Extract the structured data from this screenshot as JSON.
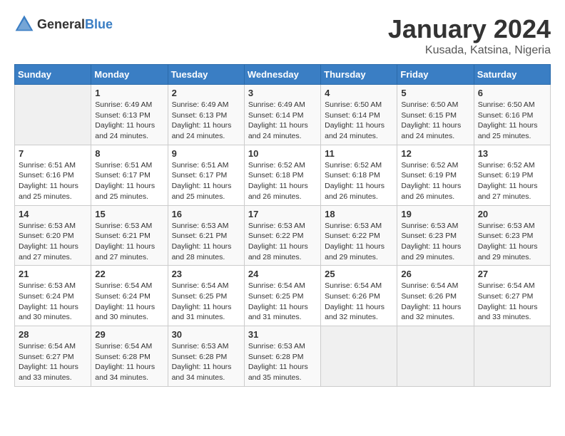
{
  "header": {
    "logo_general": "General",
    "logo_blue": "Blue",
    "month": "January 2024",
    "location": "Kusada, Katsina, Nigeria"
  },
  "weekdays": [
    "Sunday",
    "Monday",
    "Tuesday",
    "Wednesday",
    "Thursday",
    "Friday",
    "Saturday"
  ],
  "weeks": [
    [
      {
        "day": "",
        "info": ""
      },
      {
        "day": "1",
        "info": "Sunrise: 6:49 AM\nSunset: 6:13 PM\nDaylight: 11 hours and 24 minutes."
      },
      {
        "day": "2",
        "info": "Sunrise: 6:49 AM\nSunset: 6:13 PM\nDaylight: 11 hours and 24 minutes."
      },
      {
        "day": "3",
        "info": "Sunrise: 6:49 AM\nSunset: 6:14 PM\nDaylight: 11 hours and 24 minutes."
      },
      {
        "day": "4",
        "info": "Sunrise: 6:50 AM\nSunset: 6:14 PM\nDaylight: 11 hours and 24 minutes."
      },
      {
        "day": "5",
        "info": "Sunrise: 6:50 AM\nSunset: 6:15 PM\nDaylight: 11 hours and 24 minutes."
      },
      {
        "day": "6",
        "info": "Sunrise: 6:50 AM\nSunset: 6:16 PM\nDaylight: 11 hours and 25 minutes."
      }
    ],
    [
      {
        "day": "7",
        "info": "Sunrise: 6:51 AM\nSunset: 6:16 PM\nDaylight: 11 hours and 25 minutes."
      },
      {
        "day": "8",
        "info": "Sunrise: 6:51 AM\nSunset: 6:17 PM\nDaylight: 11 hours and 25 minutes."
      },
      {
        "day": "9",
        "info": "Sunrise: 6:51 AM\nSunset: 6:17 PM\nDaylight: 11 hours and 25 minutes."
      },
      {
        "day": "10",
        "info": "Sunrise: 6:52 AM\nSunset: 6:18 PM\nDaylight: 11 hours and 26 minutes."
      },
      {
        "day": "11",
        "info": "Sunrise: 6:52 AM\nSunset: 6:18 PM\nDaylight: 11 hours and 26 minutes."
      },
      {
        "day": "12",
        "info": "Sunrise: 6:52 AM\nSunset: 6:19 PM\nDaylight: 11 hours and 26 minutes."
      },
      {
        "day": "13",
        "info": "Sunrise: 6:52 AM\nSunset: 6:19 PM\nDaylight: 11 hours and 27 minutes."
      }
    ],
    [
      {
        "day": "14",
        "info": "Sunrise: 6:53 AM\nSunset: 6:20 PM\nDaylight: 11 hours and 27 minutes."
      },
      {
        "day": "15",
        "info": "Sunrise: 6:53 AM\nSunset: 6:21 PM\nDaylight: 11 hours and 27 minutes."
      },
      {
        "day": "16",
        "info": "Sunrise: 6:53 AM\nSunset: 6:21 PM\nDaylight: 11 hours and 28 minutes."
      },
      {
        "day": "17",
        "info": "Sunrise: 6:53 AM\nSunset: 6:22 PM\nDaylight: 11 hours and 28 minutes."
      },
      {
        "day": "18",
        "info": "Sunrise: 6:53 AM\nSunset: 6:22 PM\nDaylight: 11 hours and 29 minutes."
      },
      {
        "day": "19",
        "info": "Sunrise: 6:53 AM\nSunset: 6:23 PM\nDaylight: 11 hours and 29 minutes."
      },
      {
        "day": "20",
        "info": "Sunrise: 6:53 AM\nSunset: 6:23 PM\nDaylight: 11 hours and 29 minutes."
      }
    ],
    [
      {
        "day": "21",
        "info": "Sunrise: 6:53 AM\nSunset: 6:24 PM\nDaylight: 11 hours and 30 minutes."
      },
      {
        "day": "22",
        "info": "Sunrise: 6:54 AM\nSunset: 6:24 PM\nDaylight: 11 hours and 30 minutes."
      },
      {
        "day": "23",
        "info": "Sunrise: 6:54 AM\nSunset: 6:25 PM\nDaylight: 11 hours and 31 minutes."
      },
      {
        "day": "24",
        "info": "Sunrise: 6:54 AM\nSunset: 6:25 PM\nDaylight: 11 hours and 31 minutes."
      },
      {
        "day": "25",
        "info": "Sunrise: 6:54 AM\nSunset: 6:26 PM\nDaylight: 11 hours and 32 minutes."
      },
      {
        "day": "26",
        "info": "Sunrise: 6:54 AM\nSunset: 6:26 PM\nDaylight: 11 hours and 32 minutes."
      },
      {
        "day": "27",
        "info": "Sunrise: 6:54 AM\nSunset: 6:27 PM\nDaylight: 11 hours and 33 minutes."
      }
    ],
    [
      {
        "day": "28",
        "info": "Sunrise: 6:54 AM\nSunset: 6:27 PM\nDaylight: 11 hours and 33 minutes."
      },
      {
        "day": "29",
        "info": "Sunrise: 6:54 AM\nSunset: 6:28 PM\nDaylight: 11 hours and 34 minutes."
      },
      {
        "day": "30",
        "info": "Sunrise: 6:53 AM\nSunset: 6:28 PM\nDaylight: 11 hours and 34 minutes."
      },
      {
        "day": "31",
        "info": "Sunrise: 6:53 AM\nSunset: 6:28 PM\nDaylight: 11 hours and 35 minutes."
      },
      {
        "day": "",
        "info": ""
      },
      {
        "day": "",
        "info": ""
      },
      {
        "day": "",
        "info": ""
      }
    ]
  ]
}
